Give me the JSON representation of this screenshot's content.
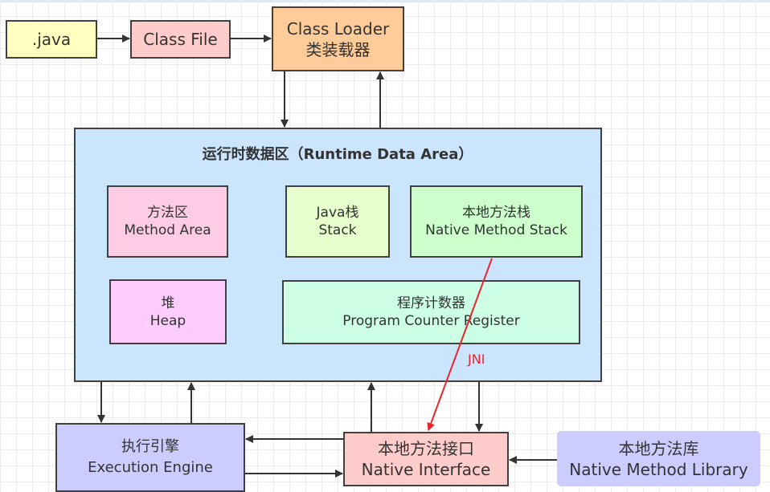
{
  "colors": {
    "java": "#ffffc0",
    "class_file": "#ffcccc",
    "class_loader": "#ffcc99",
    "runtime": "#cce5ff",
    "method_area": "#ffcce6",
    "java_stack": "#e6ffcc",
    "native_stack": "#ccffcc",
    "heap": "#ffccff",
    "pc_register": "#ccffe6",
    "execution_engine": "#ccccff",
    "native_interface": "#ffcccc",
    "native_library": "#ccccff",
    "jni": "#e8262d"
  },
  "nodes": {
    "java": {
      "label": ".java"
    },
    "class_file": {
      "label": "Class File"
    },
    "class_loader": {
      "line1": "Class Loader",
      "line2": "类装载器"
    },
    "runtime": {
      "title": "运行时数据区（Runtime Data Area）"
    },
    "method_area": {
      "line1": "方法区",
      "line2": "Method Area"
    },
    "java_stack": {
      "line1": "Java栈",
      "line2": "Stack"
    },
    "native_stack": {
      "line1": "本地方法栈",
      "line2": "Native Method Stack"
    },
    "heap": {
      "line1": "堆",
      "line2": "Heap"
    },
    "pc_register": {
      "line1": "程序计数器",
      "line2": "Program Counter Register"
    },
    "execution_engine": {
      "line1": "执行引擎",
      "line2": "Execution Engine"
    },
    "native_interface": {
      "line1": "本地方法接口",
      "line2": "Native Interface"
    },
    "native_library": {
      "line1": "本地方法库",
      "line2": "Native Method Library"
    }
  },
  "edges": {
    "jni_label": "JNI"
  }
}
